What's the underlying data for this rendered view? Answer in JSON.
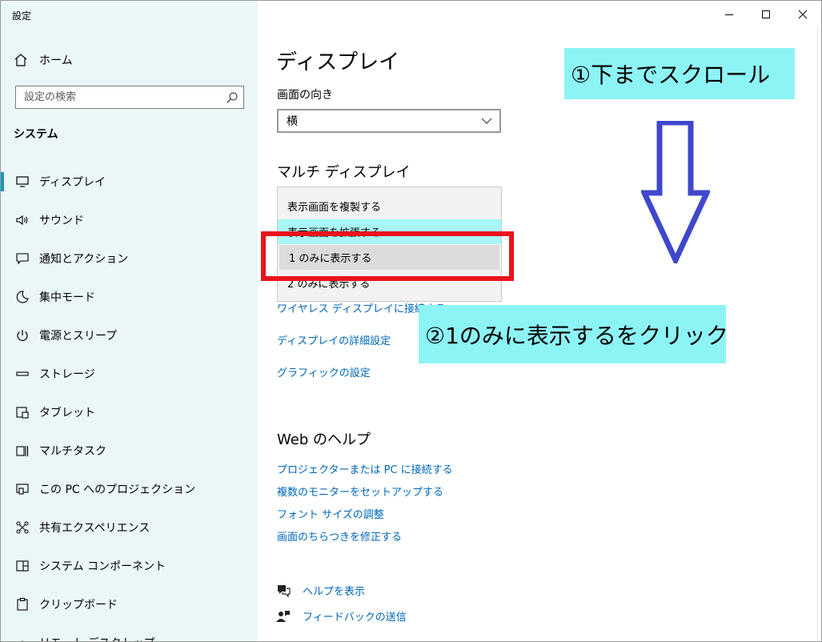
{
  "window": {
    "title": "設定",
    "controls": [
      "minimize",
      "maximize",
      "close"
    ]
  },
  "sidebar": {
    "home_label": "ホーム",
    "search_placeholder": "設定の検索",
    "section_title": "システム",
    "items": [
      {
        "label": "ディスプレイ",
        "icon": "monitor-icon",
        "active": true
      },
      {
        "label": "サウンド",
        "icon": "speaker-icon"
      },
      {
        "label": "通知とアクション",
        "icon": "notification-icon"
      },
      {
        "label": "集中モード",
        "icon": "moon-icon"
      },
      {
        "label": "電源とスリープ",
        "icon": "power-icon"
      },
      {
        "label": "ストレージ",
        "icon": "storage-icon"
      },
      {
        "label": "タブレット",
        "icon": "tablet-icon"
      },
      {
        "label": "マルチタスク",
        "icon": "multitask-icon"
      },
      {
        "label": "この PC へのプロジェクション",
        "icon": "projection-icon"
      },
      {
        "label": "共有エクスペリエンス",
        "icon": "share-icon"
      },
      {
        "label": "システム コンポーネント",
        "icon": "component-icon"
      },
      {
        "label": "クリップボード",
        "icon": "clipboard-icon"
      },
      {
        "label": "リモート デスクトップ",
        "icon": "remote-icon"
      }
    ]
  },
  "main": {
    "title": "ディスプレイ",
    "orientation_label": "画面の向き",
    "orientation_value": "横",
    "multi_display_title": "マルチ ディスプレイ",
    "dropdown_options": [
      "表示画面を複製する",
      "表示画面を拡張する",
      "1 のみに表示する",
      "2 のみに表示する"
    ],
    "selected_option": "1 のみに表示する",
    "links": {
      "wireless": "ワイヤレス ディスプレイに接続する",
      "advanced": "ディスプレイの詳細設定",
      "graphics": "グラフィックの設定"
    },
    "web_help_title": "Web のヘルプ",
    "web_help_links": [
      "プロジェクターまたは PC に接続する",
      "複数のモニターをセットアップする",
      "フォント サイズの調整",
      "画面のちらつきを修正する"
    ],
    "help_label": "ヘルプを表示",
    "feedback_label": "フィードバックの送信"
  },
  "annotations": {
    "step1": "①下までスクロール",
    "step2": "②1のみに表示するをクリック",
    "callout_color": "#8df4f6",
    "box_color": "#e8141c",
    "arrow_color": "#3f48cc"
  }
}
